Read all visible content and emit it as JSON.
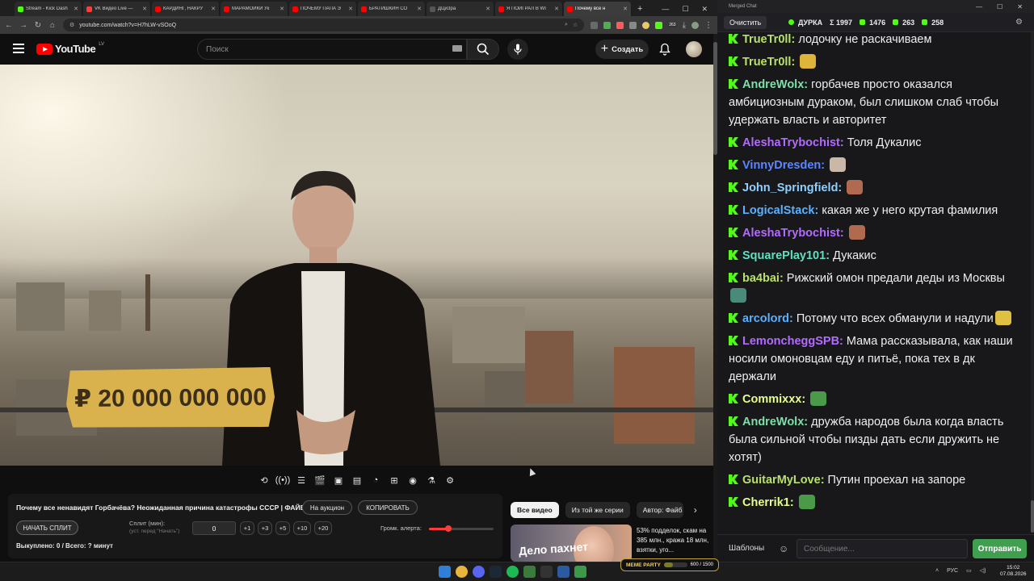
{
  "browser": {
    "tabs": [
      {
        "title": "Stream - Kick Dash",
        "color": "#53fc18"
      },
      {
        "title": "VK Видео Live —",
        "color": "#ff3b3b"
      },
      {
        "title": "КАРДИНГ, НАКРУ",
        "color": "#ff0000"
      },
      {
        "title": "МАРАМОЙКИ Ук",
        "color": "#ff0000"
      },
      {
        "title": "ПОЧЕМУ ПАПА Э",
        "color": "#ff0000"
      },
      {
        "title": "БРАТИШКИН СО",
        "color": "#ff0000"
      },
      {
        "title": "ДЦиЗра",
        "color": "#555555"
      },
      {
        "title": "Я ПОИГРАЛ В WI",
        "color": "#ff0000"
      },
      {
        "title": "Почему все н",
        "color": "#ff0000",
        "active": true
      }
    ],
    "url": "youtube.com/watch?v=H7hLW-vSOoQ",
    "ext_badge": "263"
  },
  "youtube": {
    "logo_text": "YouTube",
    "logo_region": "LV",
    "search_placeholder": "Поиск",
    "create_label": "Создать",
    "video_overlay_text": "₽ 20 000 000 000",
    "video_title": "Почему все ненавидят Горбачёва? Неожиданная причина катастрофы СССР | ФАЙБ",
    "auction_label": "На аукцион",
    "copy_label": "КОПИРОВАТЬ",
    "start_split_label": "НАЧАТЬ СПЛИТ",
    "split_label": "Сплит (мин):",
    "split_hint": "(уст. перед \"Начать\")",
    "split_value": "0",
    "increments": [
      "+1",
      "+3",
      "+5",
      "+10",
      "+20"
    ],
    "alert_volume_label": "Громк. алерта:",
    "alert_volume": 0.3,
    "sold_text": "Выкуплено: 0 / Всего: ? минут",
    "chips": [
      "Все видео",
      "Из той же серии",
      "Автор: Файб"
    ],
    "rec_thumb_text": "Дело пахнет",
    "rec_desc": "53% подделок, скам на 385 млн., кража 18 млн, взятки, уго..."
  },
  "chat": {
    "window_title": "Merged Chat",
    "clear_label": "Очистить",
    "streamer": "ДУРКА",
    "stats": [
      {
        "label": "Σ 1997",
        "color": "#dddddd"
      },
      {
        "label": "1476",
        "color": "#53fc18"
      },
      {
        "label": "263",
        "color": "#53fc18"
      },
      {
        "label": "258",
        "color": "#53fc18"
      }
    ],
    "messages": [
      {
        "nick": "TrueTr0ll",
        "color": "#b9e16a",
        "text": " лодочку не раскачиваем"
      },
      {
        "nick": "TrueTr0ll",
        "color": "#b9e16a",
        "text": " ",
        "emote": "#e0b43a"
      },
      {
        "nick": "AndreWolx",
        "color": "#7ee0a8",
        "text": " горбачев просто оказался амбициозным дураком, был слишком слаб чтобы удержать власть и авторитет"
      },
      {
        "nick": "AleshaTrybochist",
        "color": "#b36bff",
        "text": " Толя Дукалис"
      },
      {
        "nick": "VinnyDresden",
        "color": "#5b86ff",
        "text": " ",
        "emote": "#c9b8a8"
      },
      {
        "nick": "John_Springfield",
        "color": "#8fd0ff",
        "text": " ",
        "emote": "#b06a50"
      },
      {
        "nick": "LogicalStack",
        "color": "#5bb0ff",
        "text": " какая же у него крутая фамилия"
      },
      {
        "nick": "AleshaTrybochist",
        "color": "#b36bff",
        "text": " ",
        "emote": "#b06a50"
      },
      {
        "nick": "SquarePlay101",
        "color": "#5fe0c0",
        "text": " Дукакис"
      },
      {
        "nick": "ba4bai",
        "color": "#b9e16a",
        "text": " Рижский омон предали деды из Москвы",
        "emote": "#4a8a7a"
      },
      {
        "nick": "arcolord",
        "color": "#5bb0ff",
        "text": " Потому что всех обманули и надули",
        "emote": "#e0c040"
      },
      {
        "nick": "LemoncheggSPB",
        "color": "#b36bff",
        "text": " Мама рассказывала, как наши носили омоновцам еду и питьё, пока тех в дк держали"
      },
      {
        "nick": "Commixxx",
        "color": "#e6ff8a",
        "text": " ",
        "emote": "#4a9a4a"
      },
      {
        "nick": "AndreWolx",
        "color": "#7ee0a8",
        "text": " дружба народов была когда власть была сильной чтобы пизды дать если дружить не хотят)"
      },
      {
        "nick": "GuitarMyLove",
        "color": "#b9e16a",
        "text": " Путин проехал на запоре"
      },
      {
        "nick": "Cherrik1",
        "color": "#e6ff8a",
        "text": " ",
        "emote": "#4a9a4a"
      }
    ],
    "templates_label": "Шаблоны",
    "input_placeholder": "Сообщение...",
    "send_label": "Отправить"
  },
  "overlay": {
    "meme_label": "MEME PARTY",
    "progress_text": "600 / 1500",
    "progress": 0.4
  },
  "taskbar": {
    "lang": "РУС",
    "time": "15:02",
    "date": "07.08.2026"
  }
}
